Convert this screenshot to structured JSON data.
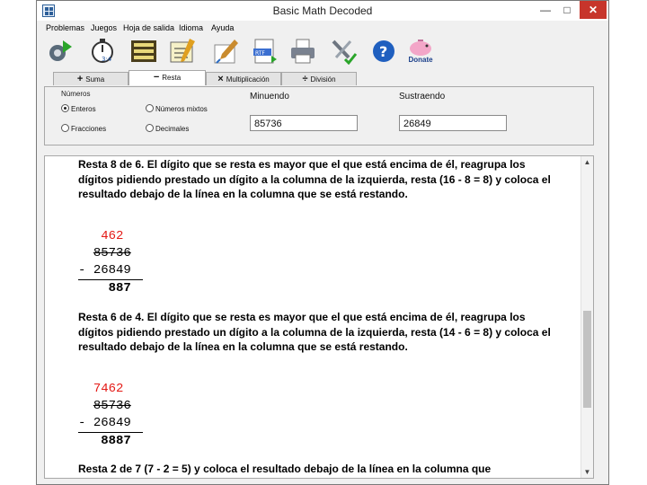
{
  "window": {
    "title": "Basic Math Decoded"
  },
  "menu": [
    "Problemas",
    "Juegos",
    "Hoja de salida",
    "Idioma",
    "Ayuda"
  ],
  "toolbar": {
    "donate_label": "Donate"
  },
  "tabs": [
    {
      "label": "Suma",
      "symbol": "+"
    },
    {
      "label": "Resta",
      "symbol": "−"
    },
    {
      "label": "Multiplicación",
      "symbol": "×"
    },
    {
      "label": "División",
      "symbol": "÷"
    }
  ],
  "number_type": {
    "label": "Números",
    "options": [
      "Enteros",
      "Números mixtos",
      "Fracciones",
      "Decimales"
    ],
    "selected": "Enteros"
  },
  "minuend": {
    "label": "Minuendo",
    "value": "85736"
  },
  "subtrahend": {
    "label": "Sustraendo",
    "value": "26849"
  },
  "steps": [
    {
      "text": "Resta 8 de 6. El dígito que se resta es mayor que el que está encima de él, reagrupa los dígitos pidiendo prestado un dígito a la columna de la izquierda, resta (16 - 8 = 8) y coloca el resultado debajo de la línea en la columna que se está restando.",
      "borrow": "462",
      "minuend": "85736",
      "subtrahend": "26849",
      "operator": "-",
      "result": "887"
    },
    {
      "text": "Resta 6 de 4. El dígito que se resta es mayor que el que está encima de él, reagrupa los dígitos pidiendo prestado un dígito a la columna de la izquierda, resta (14 - 6 = 8) y coloca el resultado debajo de la línea en la columna que se está restando.",
      "borrow": "7462",
      "minuend": "85736",
      "subtrahend": "26849",
      "operator": "-",
      "result": "8887"
    },
    {
      "text": "Resta 2 de 7 (7 - 2 = 5) y coloca el resultado debajo de la línea en la columna que"
    }
  ],
  "icons": [
    "app-icon",
    "settings-icon",
    "timer-icon",
    "worksheet-icon",
    "practice-icon",
    "eraser-icon",
    "export-rtf-icon",
    "printer-icon",
    "tools-icon",
    "help-icon",
    "piggy-bank-icon"
  ]
}
